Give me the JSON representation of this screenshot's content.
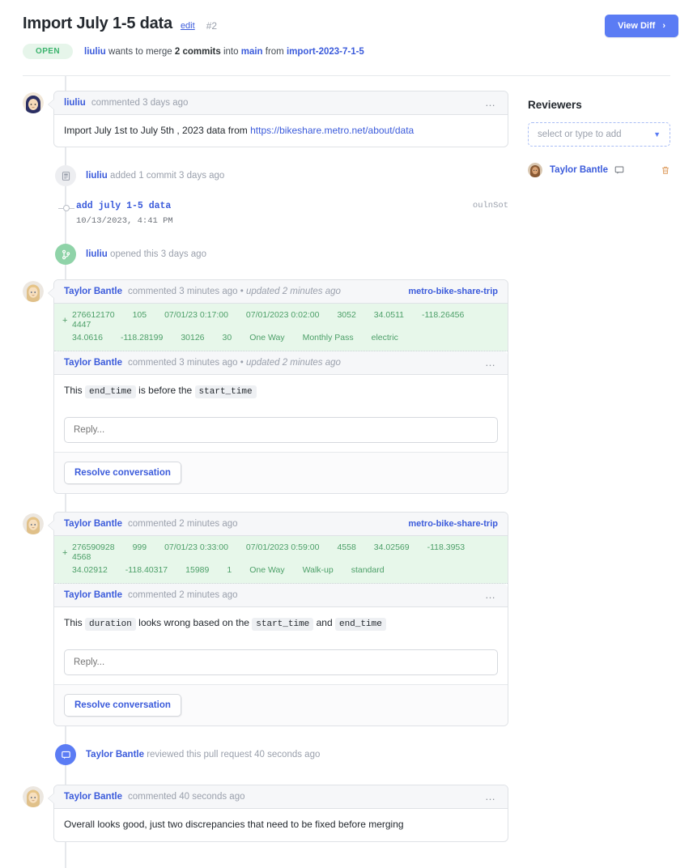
{
  "header": {
    "title": "Import July 1-5 data",
    "edit_label": "edit",
    "pr_number": "#2",
    "view_diff_label": "View Diff",
    "view_diff_chevron": "›",
    "status_badge": "OPEN",
    "meta": {
      "author": "liuliu",
      "wants_to_merge": "wants to merge",
      "commits": "2 commits",
      "into": "into",
      "base_branch": "main",
      "from": "from",
      "head_branch": "import-2023-7-1-5"
    },
    "accent_color": "#5b7cf4",
    "link_color": "#3b5bdb",
    "open_badge_color": "#3cb46e"
  },
  "timeline": [
    {
      "kind": "comment",
      "avatar": "liuliu-avatar",
      "author": "liuliu",
      "action": "commented 3 days ago",
      "kebab": "…",
      "body_prefix": "Import July 1st to July 5th , 2023 data from ",
      "body_link": "https://bikeshare.metro.net/about/data"
    },
    {
      "kind": "event",
      "icon": "commit-icon",
      "author": "liuliu",
      "text": "added 1 commit 3 days ago"
    },
    {
      "kind": "commit",
      "message": "add july 1-5 data",
      "date": "10/13/2023, 4:41 PM",
      "sha": "oulnSot"
    },
    {
      "kind": "event",
      "icon": "branch-icon",
      "author": "liuliu",
      "text": "opened this 3 days ago"
    },
    {
      "kind": "review-thread",
      "avatar": "taylor-avatar",
      "head": {
        "author": "Taylor Bantle",
        "action": "commented 3 minutes ago • ",
        "action_italic": "updated 2 minutes ago",
        "filename": "metro-bike-share-trip"
      },
      "diff": {
        "sign": "+",
        "line1": [
          "276612170",
          "105",
          "07/01/23 0:17:00",
          "07/01/2023 0:02:00",
          "3052",
          "34.0511",
          "-118.26456",
          "4447"
        ],
        "line2": [
          "34.0616",
          "-118.28199",
          "30126",
          "30",
          "One Way",
          "Monthly Pass",
          "electric"
        ]
      },
      "comment": {
        "author": "Taylor Bantle",
        "action": "commented 3 minutes ago • ",
        "action_italic": "updated 2 minutes ago",
        "kebab": "…",
        "text_1": "This ",
        "code_1": "end_time",
        "text_2": " is before the ",
        "code_2": "start_time"
      },
      "reply_placeholder": "Reply...",
      "resolve_label": "Resolve conversation"
    },
    {
      "kind": "review-thread",
      "avatar": "taylor-avatar",
      "head": {
        "author": "Taylor Bantle",
        "action": "commented 2 minutes ago",
        "action_italic": "",
        "filename": "metro-bike-share-trip"
      },
      "diff": {
        "sign": "+",
        "line1": [
          "276590928",
          "999",
          "07/01/23 0:33:00",
          "07/01/2023 0:59:00",
          "4558",
          "34.02569",
          "-118.3953",
          "4568"
        ],
        "line2": [
          "34.02912",
          "-118.40317",
          "15989",
          "1",
          "One Way",
          "Walk-up",
          "standard"
        ]
      },
      "comment": {
        "author": "Taylor Bantle",
        "action": "commented 2 minutes ago",
        "action_italic": "",
        "kebab": "…",
        "text_1": "This ",
        "code_1": "duration",
        "text_2": " looks wrong based on the ",
        "code_2": "start_time",
        "text_3": " and ",
        "code_3": "end_time"
      },
      "reply_placeholder": "Reply...",
      "resolve_label": "Resolve conversation"
    },
    {
      "kind": "event",
      "icon": "review-icon",
      "author": "Taylor Bantle",
      "text": "reviewed this pull request 40 seconds ago"
    },
    {
      "kind": "comment",
      "avatar": "taylor-avatar",
      "author": "Taylor Bantle",
      "action": "commented 40 seconds ago",
      "kebab": "…",
      "body_prefix": "Overall looks good, just two discrepancies that need to be fixed before merging",
      "body_link": ""
    }
  ],
  "sidebar": {
    "title": "Reviewers",
    "select_placeholder": "select or type to add",
    "caret": "▼",
    "reviewers": [
      {
        "name": "Taylor Bantle",
        "avatar": "reviewer-avatar"
      }
    ]
  }
}
